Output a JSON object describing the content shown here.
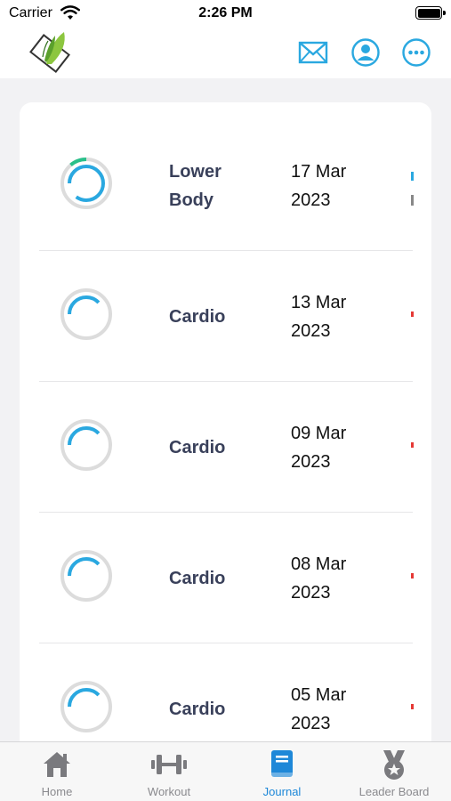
{
  "status_bar": {
    "carrier": "Carrier",
    "time": "2:26 PM"
  },
  "header": {
    "logo_icon": "leaf-logo-icon",
    "actions": [
      {
        "icon": "mail-icon"
      },
      {
        "icon": "profile-icon"
      },
      {
        "icon": "more-icon"
      }
    ]
  },
  "journal": {
    "entries": [
      {
        "name": "Lower Body",
        "date": "17 Mar 2023",
        "progress": 0.85,
        "accent": "#29c08a"
      },
      {
        "name": "Cardio",
        "date": "13 Mar 2023",
        "progress": 0.38,
        "accent": "#2aa8e0"
      },
      {
        "name": "Cardio",
        "date": "09 Mar 2023",
        "progress": 0.38,
        "accent": "#2aa8e0"
      },
      {
        "name": "Cardio",
        "date": "08 Mar 2023",
        "progress": 0.38,
        "accent": "#2aa8e0"
      },
      {
        "name": "Cardio",
        "date": "05 Mar 2023",
        "progress": 0.38,
        "accent": "#2aa8e0"
      }
    ]
  },
  "tab_bar": {
    "active": "Journal",
    "tabs": [
      {
        "label": "Home",
        "icon": "home-icon"
      },
      {
        "label": "Workout",
        "icon": "dumbbell-icon"
      },
      {
        "label": "Journal",
        "icon": "journal-book-icon"
      },
      {
        "label": "Leader Board",
        "icon": "medal-icon"
      }
    ]
  },
  "colors": {
    "accent": "#1e88d8",
    "ring_track": "#dcdcdc",
    "title_text": "#39405a"
  }
}
